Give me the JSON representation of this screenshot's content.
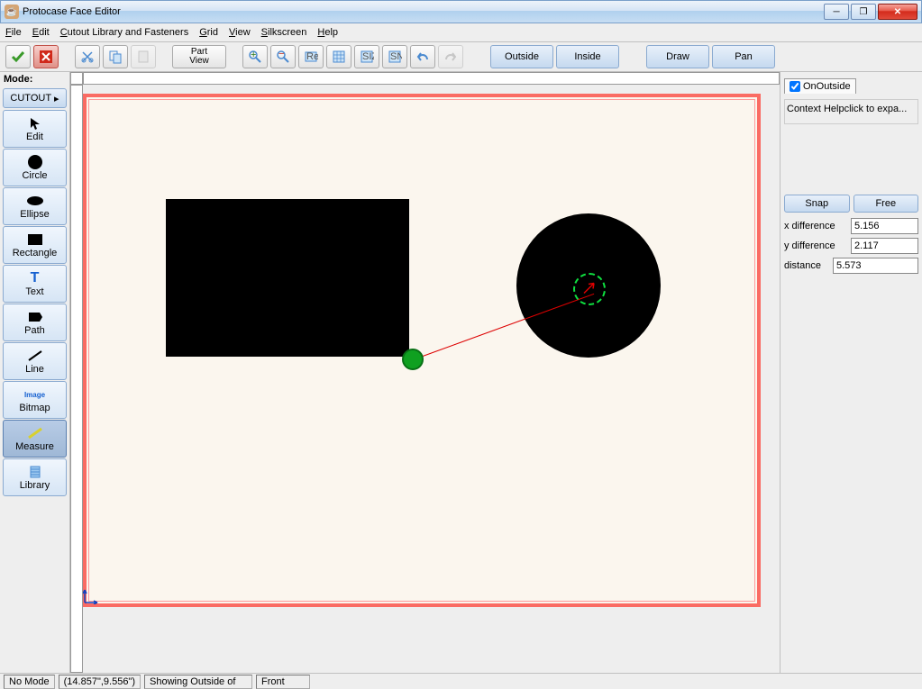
{
  "window": {
    "title": "Protocase Face Editor"
  },
  "menu": {
    "file": "File",
    "edit": "Edit",
    "cutout": "Cutout Library and Fasteners",
    "grid": "Grid",
    "view": "View",
    "silkscreen": "Silkscreen",
    "help": "Help"
  },
  "toolbar": {
    "partview": "Part\nView",
    "outside": "Outside",
    "inside": "Inside",
    "draw": "Draw",
    "pan": "Pan"
  },
  "palette": {
    "header": "Mode:",
    "mode": "CUTOUT",
    "tools": {
      "edit": "Edit",
      "circle": "Circle",
      "ellipse": "Ellipse",
      "rectangle": "Rectangle",
      "text": "Text",
      "path": "Path",
      "line": "Line",
      "bitmap": "Bitmap",
      "measure": "Measure",
      "library": "Library"
    }
  },
  "rpanel": {
    "tab": "OnOutside",
    "help": "Context Helpclick to expa...",
    "snap": "Snap",
    "free": "Free",
    "xdiff_label": "x difference",
    "xdiff": "5.156",
    "ydiff_label": "y difference",
    "ydiff": "2.117",
    "dist_label": "distance",
    "dist": "5.573"
  },
  "status": {
    "mode": "No Mode",
    "coords": "(14.857\",9.556\")",
    "showing": "Showing Outside of",
    "face": "Front"
  }
}
